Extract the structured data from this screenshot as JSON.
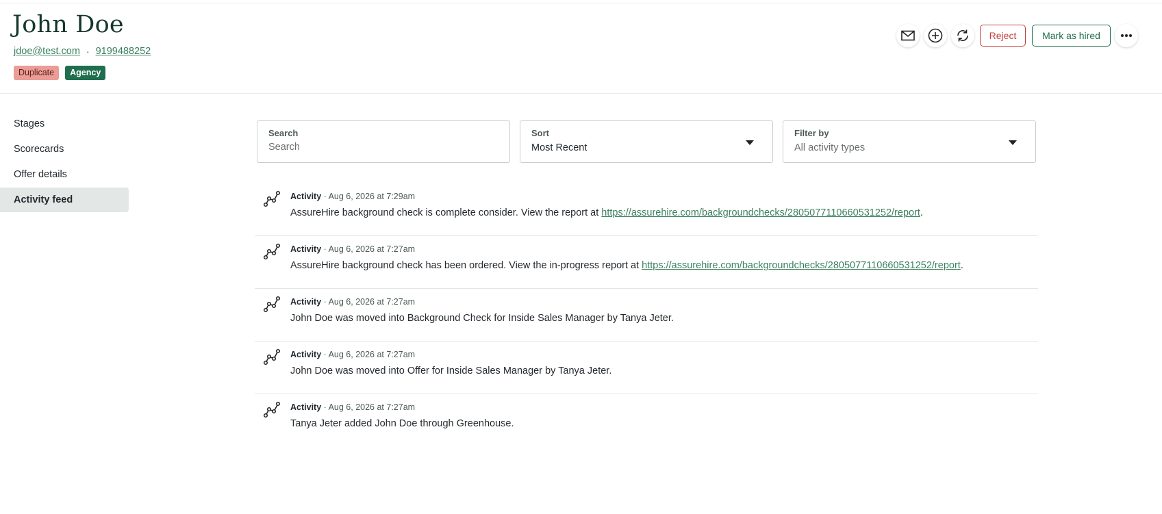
{
  "candidate": {
    "name": "John Doe",
    "email": "jdoe@test.com",
    "separator": "·",
    "phone": "9199488252",
    "tags": [
      "Duplicate",
      "Agency"
    ]
  },
  "actions": {
    "icons": [
      "mail-icon",
      "add-circle-icon",
      "refresh-icon",
      "more-horizontal-icon"
    ],
    "reject_label": "Reject",
    "hired_label": "Mark as hired"
  },
  "sidebar": {
    "items": [
      {
        "label": "Stages"
      },
      {
        "label": "Scorecards"
      },
      {
        "label": "Offer details"
      },
      {
        "label": "Activity feed"
      }
    ],
    "active": "Activity feed"
  },
  "controls": {
    "search": {
      "label": "Search",
      "placeholder": "Search"
    },
    "sort": {
      "label": "Sort",
      "value": "Most Recent"
    },
    "filter": {
      "label": "Filter by",
      "value": "All activity types"
    }
  },
  "feed": [
    {
      "type": "Activity",
      "sep": " · ",
      "time": "Aug 6, 2026 at 7:29am",
      "text": "AssureHire background check is complete consider. View the report at ",
      "link": "https://assurehire.com/backgroundchecks/2805077110660531252/report",
      "end": "."
    },
    {
      "type": "Activity",
      "sep": " · ",
      "time": "Aug 6, 2026 at 7:27am",
      "text": "AssureHire background check has been ordered. View the in-progress report at ",
      "link": "https://assurehire.com/backgroundchecks/2805077110660531252/report",
      "end": "."
    },
    {
      "type": "Activity",
      "sep": " · ",
      "time": "Aug 6, 2026 at 7:27am",
      "text": "John Doe was moved into Background Check for Inside Sales Manager by Tanya Jeter.",
      "link": "",
      "end": ""
    },
    {
      "type": "Activity",
      "sep": " · ",
      "time": "Aug 6, 2026 at 7:27am",
      "text": "John Doe was moved into Offer for Inside Sales Manager by Tanya Jeter.",
      "link": "",
      "end": ""
    },
    {
      "type": "Activity",
      "sep": " · ",
      "time": "Aug 6, 2026 at 7:27am",
      "text": "Tanya Jeter added John Doe through Greenhouse.",
      "link": "",
      "end": ""
    }
  ]
}
